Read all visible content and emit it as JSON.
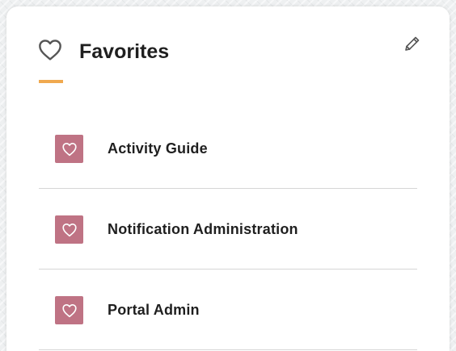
{
  "header": {
    "title": "Favorites",
    "icon": "heart-outline-icon",
    "accent_color": "#f0a94f",
    "edit_icon": "pencil-icon"
  },
  "favorites": [
    {
      "label": "Activity Guide",
      "icon": "heart-icon",
      "tile_color": "#bf7384"
    },
    {
      "label": "Notification Administration",
      "icon": "heart-icon",
      "tile_color": "#bf7384"
    },
    {
      "label": "Portal Admin",
      "icon": "heart-icon",
      "tile_color": "#bf7384"
    }
  ]
}
